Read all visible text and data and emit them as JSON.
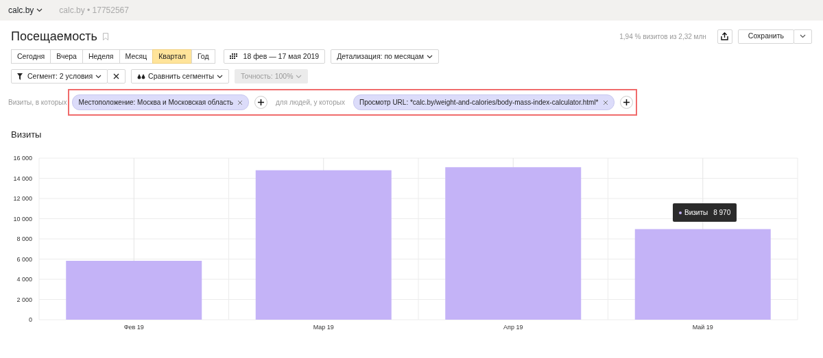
{
  "header": {
    "site": "calc.by",
    "counter": "calc.by • 17752567"
  },
  "page_title": "Посещаемость",
  "summary": "1,94 % визитов из 2,32 млн",
  "save_button": "Сохранить",
  "periods": [
    {
      "label": "Сегодня",
      "selected": false
    },
    {
      "label": "Вчера",
      "selected": false
    },
    {
      "label": "Неделя",
      "selected": false
    },
    {
      "label": "Месяц",
      "selected": false
    },
    {
      "label": "Квартал",
      "selected": true
    },
    {
      "label": "Год",
      "selected": false
    }
  ],
  "date_range": "18 фев — 17 мая 2019",
  "detail": "Детализация: по месяцам",
  "segment": "Сегмент: 2 условия",
  "compare": "Сравнить сегменты",
  "accuracy": {
    "label": "Точность: 100%",
    "disabled": true
  },
  "filter": {
    "visits_label": "Визиты, в которых",
    "visit_chips": [
      "Местоположение: Москва и Московская область"
    ],
    "people_label": "для людей, у которых",
    "people_chips": [
      "Просмотр URL: *calc.by/weight-and-calories/body-mass-index-calculator.html*"
    ]
  },
  "chart_title": "Визиты",
  "chart_data": {
    "type": "bar",
    "grid": true,
    "categories": [
      "Фев 19",
      "Мар 19",
      "Апр 19",
      "Май 19"
    ],
    "series": [
      {
        "name": "Визиты",
        "color": "#c4b3f7",
        "values": [
          5830,
          14800,
          15100,
          8970
        ]
      }
    ],
    "ylim": [
      0,
      16000
    ],
    "yticks": [
      {
        "value": 0,
        "label": "0"
      },
      {
        "value": 2000,
        "label": "2 000"
      },
      {
        "value": 4000,
        "label": "4 000"
      },
      {
        "value": 6000,
        "label": "6 000"
      },
      {
        "value": 8000,
        "label": "8 000"
      },
      {
        "value": 10000,
        "label": "10 000"
      },
      {
        "value": 12000,
        "label": "12 000"
      },
      {
        "value": 14000,
        "label": "14 000"
      },
      {
        "value": 16000,
        "label": "16 000"
      }
    ]
  },
  "tooltip": {
    "value": "8 970"
  }
}
